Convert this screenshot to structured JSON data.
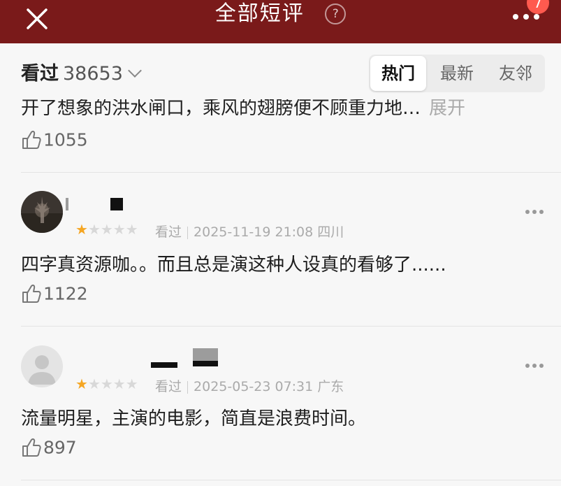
{
  "header": {
    "title": "全部短评",
    "help_symbol": "?",
    "badge": "7"
  },
  "subheader": {
    "watched_label": "看过",
    "watched_count": "38653",
    "tabs": [
      "热门",
      "最新",
      "友邻"
    ],
    "active_tab": "热门"
  },
  "prev_review": {
    "content": "开了想象的洪水闸口，乘风的翅膀便不顾重力地…",
    "expand": "展开",
    "likes": "1055"
  },
  "reviews": [
    {
      "rating": 1,
      "stars_on": "★",
      "stars_off": "★★★★",
      "status": "看过",
      "time": "2025-11-19 21:08",
      "location": "四川",
      "content": "四字真资源咖。。而且总是演这种人设真的看够了......",
      "likes": "1122"
    },
    {
      "rating": 1,
      "stars_on": "★",
      "stars_off": "★★★★",
      "status": "看过",
      "time": "2025-05-23 07:31",
      "location": "广东",
      "content": "流量明星，主演的电影，简直是浪费时间。",
      "likes": "897"
    }
  ],
  "colors": {
    "header_bg": "#7a1a1a",
    "badge": "#ff5a4f",
    "star": "#f5a623"
  }
}
